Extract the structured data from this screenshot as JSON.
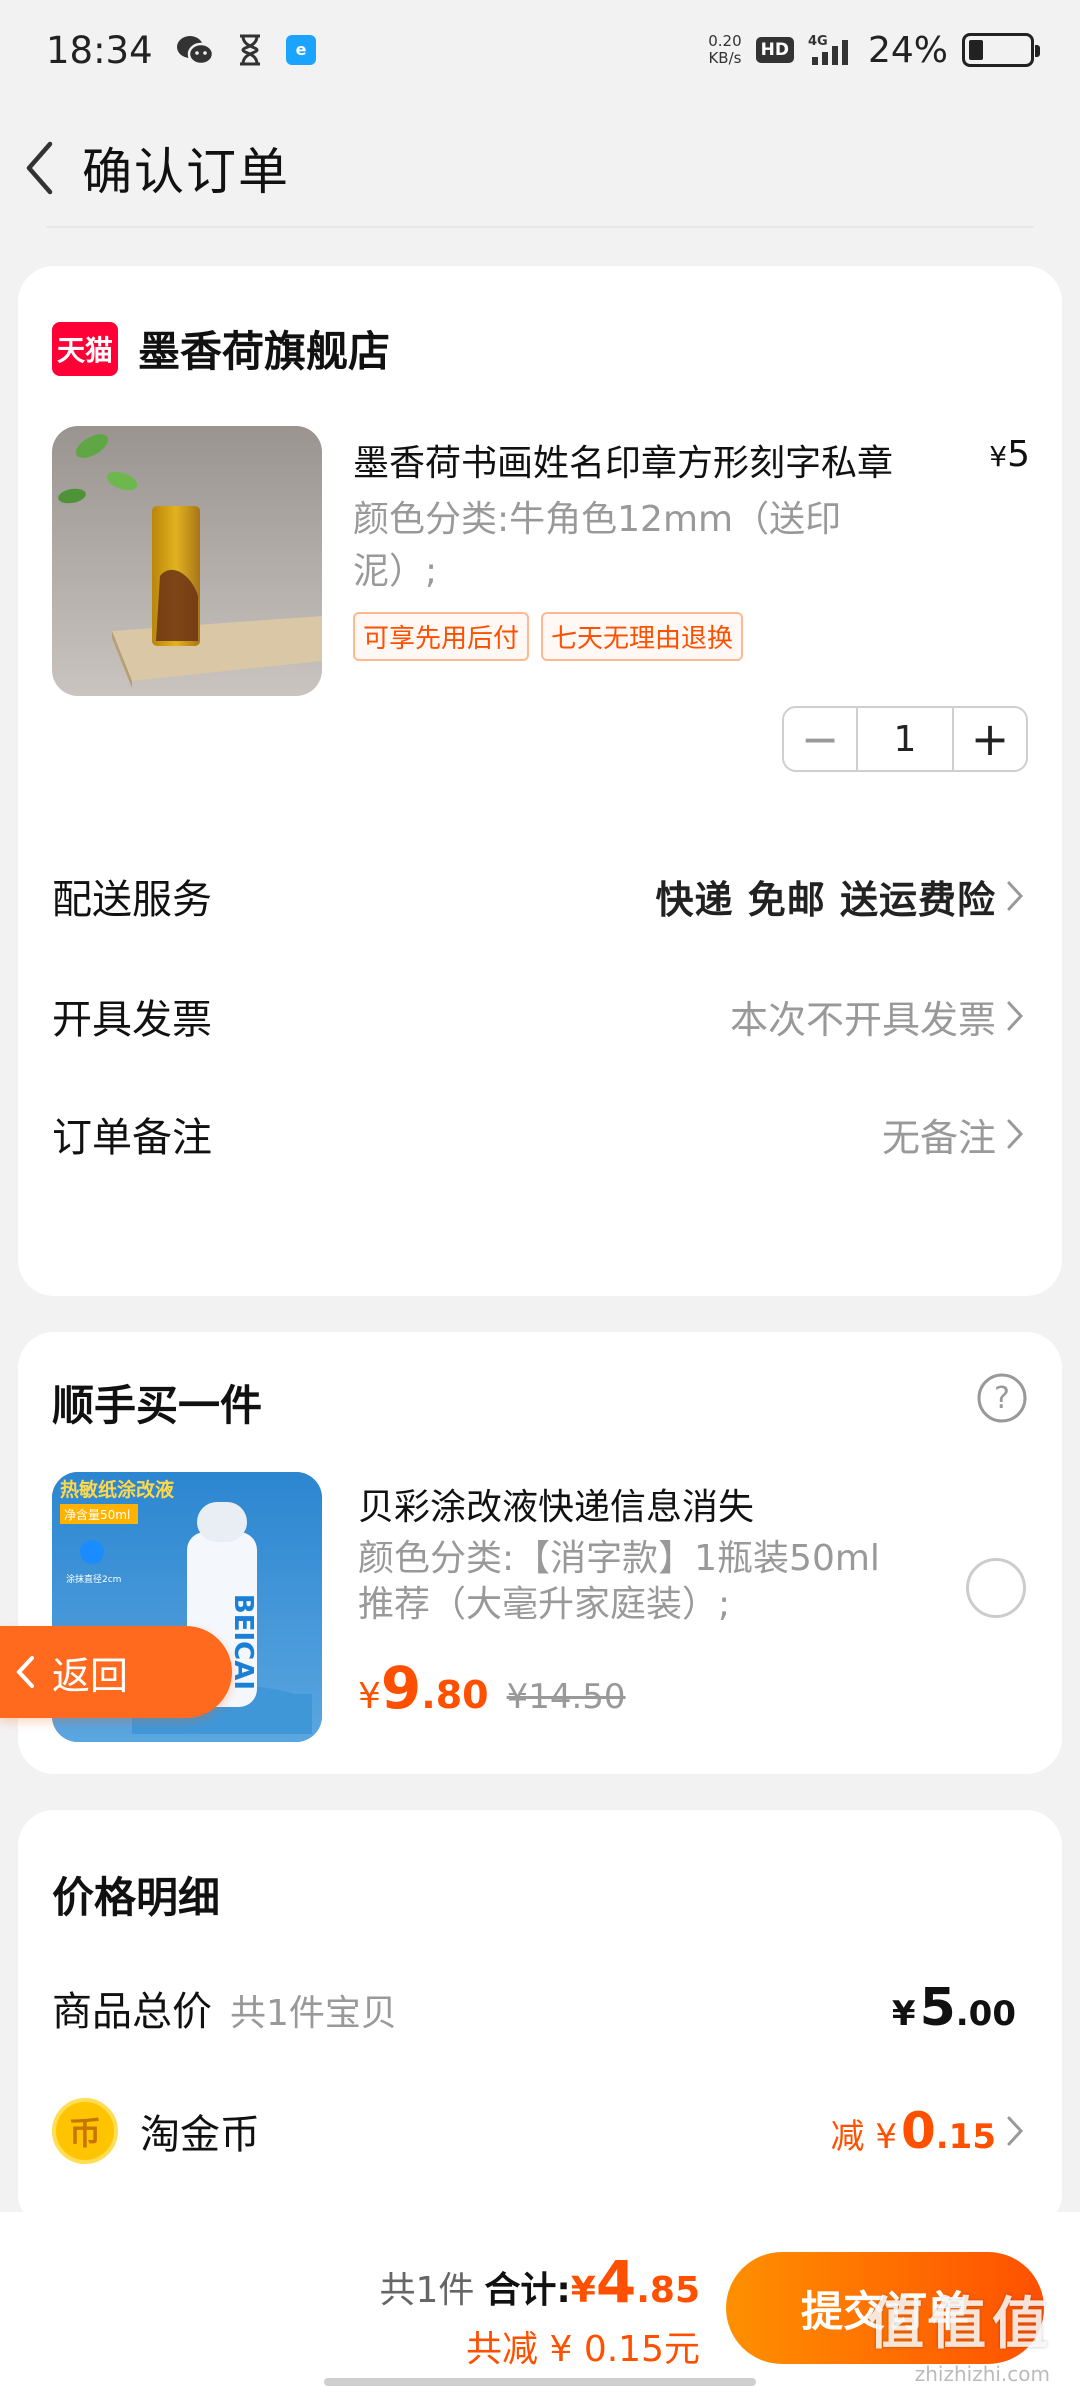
{
  "status_bar": {
    "time": "18:34",
    "net_speed_value": "0.20",
    "net_speed_unit": "KB/s",
    "hd": "HD",
    "network": "4G",
    "battery_text": "24%",
    "battery_level": 0.24,
    "left_icons": [
      "wechat-icon",
      "hourglass-icon",
      "app-e-icon"
    ]
  },
  "header": {
    "title": "确认订单",
    "back_icon": "chevron-left-icon"
  },
  "shop": {
    "logo_text": "天猫",
    "name": "墨香荷旗舰店",
    "product": {
      "title": "墨香荷书画姓名印章方形刻字私章",
      "price_symbol": "¥",
      "price": "5",
      "spec": "颜色分类:牛角色12mm（送印泥）;",
      "tags": [
        "可享先用后付",
        "七天无理由退换"
      ],
      "quantity": "1",
      "minus": "−",
      "plus": "+"
    },
    "rows": [
      {
        "label": "配送服务",
        "value": "快递 免邮 送运费险"
      },
      {
        "label": "开具发票",
        "value": "本次不开具发票"
      },
      {
        "label": "订单备注",
        "value": "无备注"
      }
    ]
  },
  "addon": {
    "title": "顺手买一件",
    "product_name": "贝彩涂改液快递信息消失",
    "spec": "颜色分类:【消字款】1瓶装50ml 推荐（大毫升家庭装）;",
    "price_symbol": "¥",
    "price_int": "9",
    "price_dec": ".80",
    "original_price": "¥14.50",
    "image_text_top": "热敏纸涂改液",
    "image_text_badge": "净含量50ml",
    "image_text_small": "涂抹直径2cm",
    "image_brand": "BEICAI"
  },
  "float_back": {
    "label": "返回"
  },
  "price_detail": {
    "title": "价格明细",
    "total_label": "商品总价",
    "total_sub": "共1件宝贝",
    "total_symbol": "¥",
    "total_int": "5",
    "total_dec": ".00",
    "coin_label": "淘金币",
    "coin_icon_text": "币",
    "coin_prefix": "减 ¥",
    "coin_int": "0",
    "coin_dec": ".15"
  },
  "bottom_bar": {
    "count": "共1件",
    "total_label": "合计:",
    "total_symbol": "¥",
    "total_int": "4",
    "total_dec": ".85",
    "saved": "共减 ¥ 0.15元",
    "submit_label": "提交订单"
  },
  "watermark": {
    "main": "值值值",
    "sub": "zhizhizhi.com"
  },
  "colors": {
    "accent": "#ff5000",
    "tmall_red": "#ff0036",
    "background": "#f2f2f2",
    "gray_text": "#999999"
  }
}
